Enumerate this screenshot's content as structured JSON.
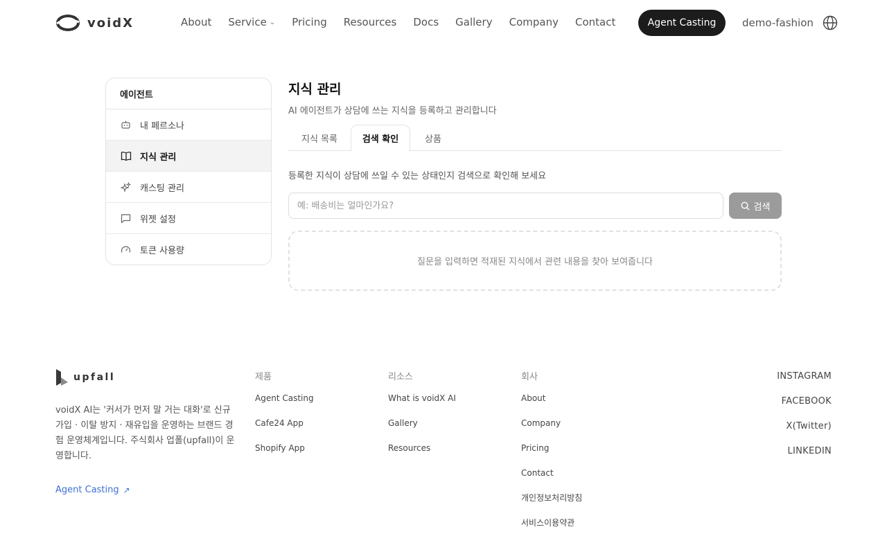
{
  "header": {
    "logo_text": "voidX",
    "nav": [
      {
        "label": "About"
      },
      {
        "label": "Service",
        "has_dropdown": true
      },
      {
        "label": "Pricing"
      },
      {
        "label": "Resources"
      },
      {
        "label": "Docs"
      },
      {
        "label": "Gallery"
      },
      {
        "label": "Company"
      },
      {
        "label": "Contact"
      }
    ],
    "cta_label": "Agent Casting",
    "account_label": "demo-fashion",
    "language_icon": "globe-icon"
  },
  "sidebar": {
    "title": "에이전트",
    "items": [
      {
        "label": "내 페르소나",
        "icon": "robot-icon",
        "active": false
      },
      {
        "label": "지식 관리",
        "icon": "book-icon",
        "active": true
      },
      {
        "label": "캐스팅 관리",
        "icon": "sparkles-icon",
        "active": false
      },
      {
        "label": "위젯 설정",
        "icon": "chat-bubble-icon",
        "active": false
      },
      {
        "label": "토큰 사용량",
        "icon": "gauge-icon",
        "active": false
      }
    ]
  },
  "main": {
    "title": "지식 관리",
    "subtitle": "AI 에이전트가 상담에 쓰는 지식을 등록하고 관리합니다",
    "tabs": [
      {
        "label": "지식 목록",
        "active": false
      },
      {
        "label": "검색 확인",
        "active": true
      },
      {
        "label": "상품",
        "active": false
      }
    ],
    "description": "등록한 지식이 상담에 쓰일 수 있는 상태인지 검색으로 확인해 보세요",
    "search": {
      "placeholder": "예: 배송비는 얼마인가요?",
      "value": "",
      "button_label": "검색"
    },
    "empty_text": "질문을 입력하면 적재된 지식에서 관련 내용을 찾아 보여줍니다"
  },
  "footer": {
    "logo_text": "upfall",
    "about": "voidX AI는 '커서가 먼저 말 거는 대화'로 신규 가입 · 이탈 방지 · 재유입을 운영하는 브랜드 경험 운영체계입니다. 주식회사 업폴(upfall)이 운영합니다.",
    "cta_label": "Agent Casting",
    "columns": [
      {
        "title": "제품",
        "links": [
          "Agent Casting",
          "Cafe24 App",
          "Shopify App"
        ]
      },
      {
        "title": "리소스",
        "links": [
          "What is voidX AI",
          "Gallery",
          "Resources"
        ]
      },
      {
        "title": "회사",
        "links": [
          "About",
          "Company",
          "Pricing",
          "Contact",
          "개인정보처리방침",
          "서비스이용약관"
        ]
      }
    ],
    "social": [
      "INSTAGRAM",
      "FACEBOOK",
      "X(Twitter)",
      "LINKEDIN"
    ]
  },
  "colors": {
    "accent_dark": "#1c1c1c",
    "link_blue": "#3d6fd6",
    "search_button": "#9b9b9b",
    "active_row": "#f3f3f4"
  }
}
